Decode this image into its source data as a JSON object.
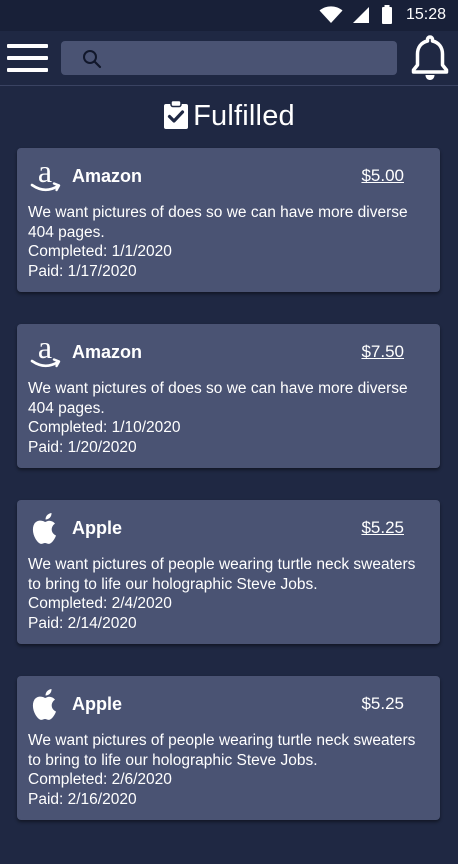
{
  "status_bar": {
    "time": "15:28"
  },
  "search": {
    "placeholder": ""
  },
  "page": {
    "title": "Fulfilled"
  },
  "cards": [
    {
      "company": "Amazon",
      "icon": "amazon-icon",
      "amount": "$5.00",
      "description": "We want pictures of does so we can have more diverse 404 pages.",
      "completed": "Completed: 1/1/2020",
      "paid": "Paid: 1/17/2020"
    },
    {
      "company": "Amazon",
      "icon": "amazon-icon",
      "amount": "$7.50",
      "description": "We want pictures of does so we can have more diverse 404 pages.",
      "completed": "Completed: 1/10/2020",
      "paid": "Paid: 1/20/2020"
    },
    {
      "company": "Apple",
      "icon": "apple-icon",
      "amount": "$5.25",
      "description": "We want pictures of people wearing turtle neck sweaters to bring to life our holographic Steve Jobs.",
      "completed": "Completed: 2/4/2020",
      "paid": "Paid: 2/14/2020"
    },
    {
      "company": "Apple",
      "icon": "apple-icon",
      "amount": "$5.25",
      "description": "We want pictures of people wearing turtle neck sweaters to bring to life our holographic Steve Jobs.",
      "completed": "Completed: 2/6/2020",
      "paid": "Paid: 2/16/2020"
    }
  ],
  "colors": {
    "background": "#1f2843",
    "card": "#4a5373",
    "search_field": "#4a5373",
    "text": "#ffffff"
  }
}
